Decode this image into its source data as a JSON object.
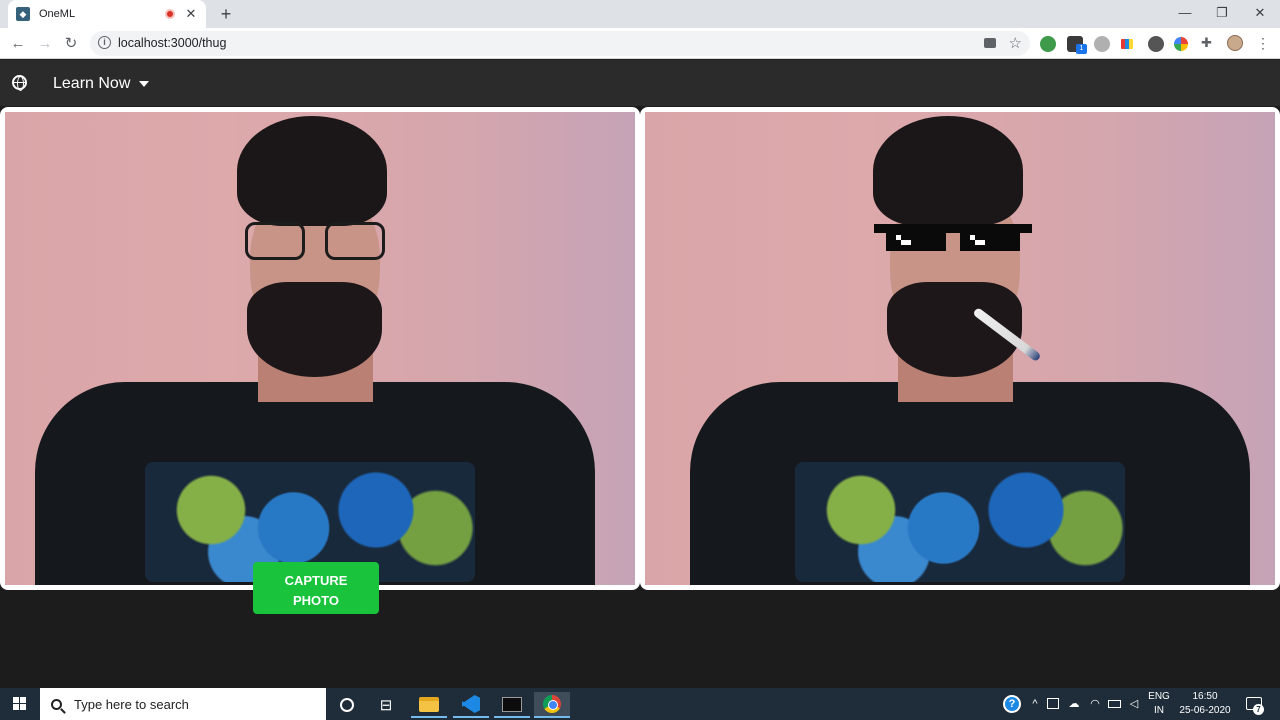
{
  "browser": {
    "tab": {
      "title": "OneML",
      "favicon": "oneml-favicon",
      "recording": true
    },
    "new_tab_label": "+",
    "window_controls": {
      "minimize": "—",
      "maximize": "❐",
      "close": "✕"
    },
    "nav": {
      "back": "←",
      "forward": "→",
      "reload": "↻"
    },
    "address": {
      "url": "localhost:3000/thug",
      "info_icon": "i"
    },
    "extension_badge_count": "1",
    "menu_glyph": "⋮"
  },
  "app": {
    "nav": {
      "globe_icon": "globe-icon",
      "menu_label": "Learn Now"
    },
    "feeds": {
      "original": {
        "name": "webcam-original"
      },
      "processed": {
        "name": "webcam-thug-filter",
        "overlays": [
          "pixel-sunglasses",
          "joint"
        ]
      }
    },
    "capture_button": {
      "line1": "CAPTURE",
      "line2": "PHOTO",
      "color": "#19c33b"
    }
  },
  "taskbar": {
    "search_placeholder": "Type here to search",
    "apps": [
      "cortana",
      "task-view",
      "file-explorer",
      "vscode",
      "terminal",
      "chrome"
    ],
    "tray": {
      "help": "?",
      "language_line1": "ENG",
      "language_line2": "IN",
      "time": "16:50",
      "date": "25-06-2020",
      "notification_count": "7"
    }
  }
}
